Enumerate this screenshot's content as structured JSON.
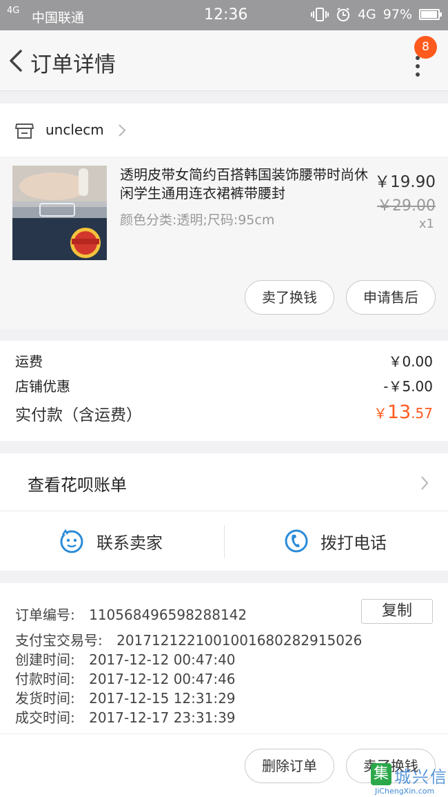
{
  "status_bar": {
    "signal": "4G",
    "carrier": "中国联通",
    "time": "12:36",
    "network": "4G",
    "battery": "97%"
  },
  "navbar": {
    "title": "订单详情",
    "badge_count": "8"
  },
  "shop": {
    "name": "unclecm"
  },
  "product": {
    "title": "透明皮带女简约百搭韩国装饰腰带时尚休闲学生通用连衣裙裤带腰封",
    "spec": "颜色分类:透明;尺码:95cm",
    "price": "￥19.90",
    "original_price": "￥29.00",
    "quantity": "x1",
    "actions": [
      "卖了换钱",
      "申请售后"
    ]
  },
  "fees": {
    "shipping_label": "运费",
    "shipping_value": "￥0.00",
    "discount_label": "店铺优惠",
    "discount_value": "-￥5.00",
    "total_label": "实付款（含运费）",
    "total_currency": "￥",
    "total_integer": "13",
    "total_decimal": ".57"
  },
  "huabei": {
    "label": "查看花呗账单"
  },
  "contact": {
    "seller_label": "联系卖家",
    "phone_label": "拨打电话"
  },
  "order_info": {
    "order_no_label": "订单编号:",
    "order_no": "110568496598288142",
    "copy_label": "复制",
    "alipay_label": "支付宝交易号:",
    "alipay_no": "2017121221001001680282915026",
    "created_label": "创建时间:",
    "created": "2017-12-12 00:47:40",
    "paid_label": "付款时间:",
    "paid": "2017-12-12 00:47:46",
    "shipped_label": "发货时间:",
    "shipped": "2017-12-15 12:31:29",
    "completed_label": "成交时间:",
    "completed": "2017-12-17 23:31:39"
  },
  "bottom_actions": [
    "删除订单",
    "卖了换钱"
  ],
  "watermark": {
    "logo_char": "集",
    "cn": "城兴信",
    "en": "JiChengXin.com"
  },
  "colors": {
    "accent": "#ff5a1e",
    "status_bar": "#9a9a9c",
    "icon_blue": "#2a8bd8"
  }
}
